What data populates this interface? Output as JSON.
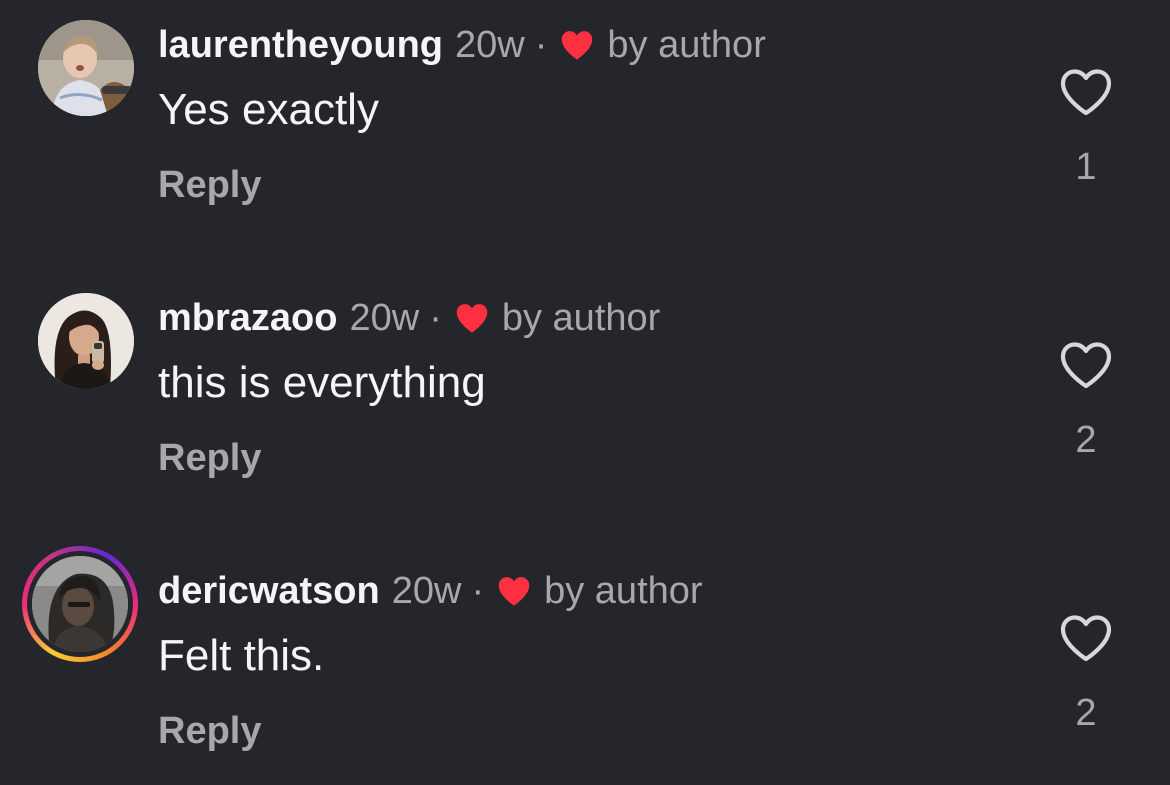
{
  "comments": [
    {
      "username": "laurentheyoung",
      "time": "20w",
      "separator": "·",
      "liked_by": "by author",
      "text": "Yes exactly",
      "reply_label": "Reply",
      "like_count": "1"
    },
    {
      "username": "mbrazaoo",
      "time": "20w",
      "separator": "·",
      "liked_by": "by author",
      "text": "this is everything",
      "reply_label": "Reply",
      "like_count": "2"
    },
    {
      "username": "dericwatson",
      "time": "20w",
      "separator": "·",
      "liked_by": "by author",
      "text": "Felt this.",
      "reply_label": "Reply",
      "like_count": "2"
    }
  ],
  "colors": {
    "background": "#25262b",
    "primary_text": "#f5f5f5",
    "secondary_text": "#a8a8a8",
    "author_heart": "#ff3040"
  }
}
